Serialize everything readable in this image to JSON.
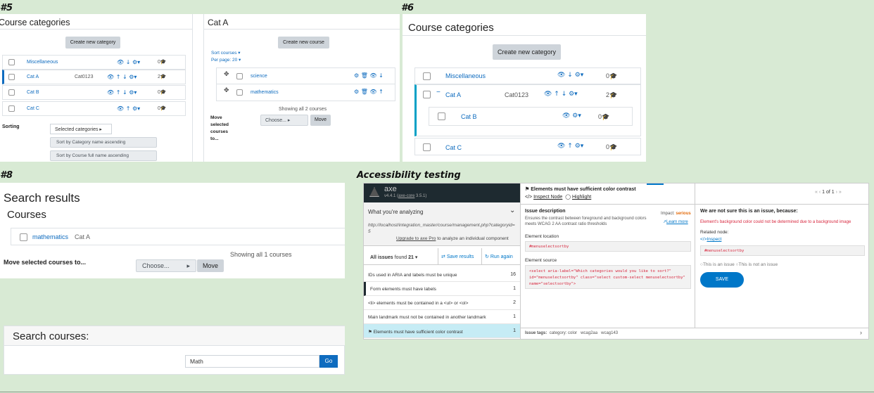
{
  "labels": {
    "s5": "#5",
    "s6": "#6",
    "s8": "#8",
    "axe": "Accessibility testing"
  },
  "p5": {
    "title": "Course categories",
    "create_btn": "Create new category",
    "categories": [
      {
        "name": "Miscellaneous",
        "idnumber": "",
        "count": "0"
      },
      {
        "name": "Cat A",
        "idnumber": "Cat0123",
        "count": "2"
      },
      {
        "name": "Cat B",
        "idnumber": "",
        "count": "0"
      },
      {
        "name": "Cat C",
        "idnumber": "",
        "count": "0"
      }
    ],
    "sorting_label": "Sorting",
    "sort_select": "Selected categories",
    "sort_opt1": "Sort by Category name ascending",
    "sort_opt2": "Sort by Course full name ascending",
    "cat_title": "Cat A",
    "create_course_btn": "Create new course",
    "sort_courses": "Sort courses",
    "per_page": "Per page: 20",
    "courses": [
      "science",
      "mathematics"
    ],
    "showing": "Showing all 2 courses",
    "move_label": "Move selected courses to...",
    "choose": "Choose...",
    "move_btn": "Move"
  },
  "p6": {
    "title": "Course categories",
    "create_btn": "Create new category",
    "categories": [
      {
        "name": "Miscellaneous",
        "idnumber": "",
        "count": "0"
      },
      {
        "name": "Cat A",
        "idnumber": "Cat0123",
        "count": "2"
      },
      {
        "name": "Cat B",
        "idnumber": "",
        "count": "0"
      },
      {
        "name": "Cat C",
        "idnumber": "",
        "count": "0"
      }
    ]
  },
  "p8": {
    "title": "Search results",
    "courses_heading": "Courses",
    "course": "mathematics",
    "course_cat": "Cat A",
    "showing": "Showing all 1 courses",
    "move_label": "Move selected courses to...",
    "choose": "Choose...",
    "move_btn": "Move",
    "search_heading": "Search courses:",
    "search_value": "Math",
    "go_btn": "Go"
  },
  "axe": {
    "logo": "axe",
    "version": "v4.4.1",
    "core": "axe-core",
    "core_version": "3.5.1",
    "analyzing": "What you're analyzing",
    "url": "http://localhost/integration_master/course/management.php?categoryid=5",
    "upgrade": "Upgrade to axe Pro",
    "upgrade_tail": "to analyze an individual component",
    "issues_label": "All issues",
    "found": "found",
    "found_count": "21",
    "save_results": "Save results",
    "run_again": "Run again",
    "issues": [
      {
        "text": "IDs used in ARIA and labels must be unique",
        "count": "16"
      },
      {
        "text": "Form elements must have labels",
        "count": "1"
      },
      {
        "text": "<li> elements must be contained in a <ul> or <ol>",
        "count": "2"
      },
      {
        "text": "Main landmark must not be contained in another landmark",
        "count": "1"
      },
      {
        "text": "Elements must have sufficient color contrast",
        "count": "1"
      }
    ],
    "detail_title": "Elements must have sufficient color contrast",
    "inspect_node": "Inspect Node",
    "highlight": "Highlight",
    "pager": "1 of 1",
    "issue_desc_h": "Issue description",
    "issue_desc": "Ensures the contrast between foreground and background colors meets WCAG 2 AA contrast ratio thresholds",
    "impact_label": "Impact:",
    "impact": "serious",
    "learn_more": "Learn more",
    "loc_h": "Element location",
    "loc": "#menuselectsortby",
    "src_h": "Element source",
    "src": "<select aria-label=\"Which categories would you like to sort?\" id=\"menuselectsortby\" class=\"select custom-select menuselectsortby\" name=\"selectsortby\">",
    "unsure_h": "We are not sure this is an issue, because:",
    "unsure_reason": "Element's background color could not be determined due to a background image",
    "related": "Related node:",
    "inspect": "Inspect",
    "related_node": "#menuselectsortby",
    "opt_issue": "This is an issue",
    "opt_not": "This is not an issue",
    "save": "SAVE",
    "tags_label": "Issue tags:",
    "tags": [
      "category: color",
      "wcag2aa",
      "wcag143"
    ],
    "colors": {
      "header_bg": "#1e2a30",
      "accent": "#0077c8",
      "danger": "#d7263d",
      "highlight_row": "#c6ecf5"
    }
  }
}
